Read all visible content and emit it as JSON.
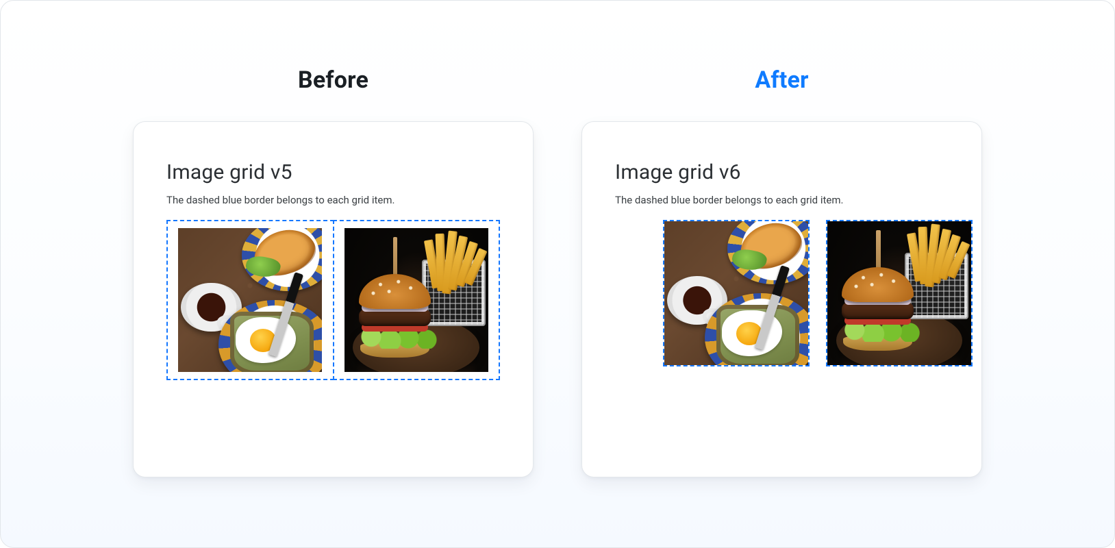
{
  "colors": {
    "accent_blue": "#0f7bff",
    "dashed_border": "#1477ff",
    "text_primary": "#1a1f24",
    "text_body": "#3b4044",
    "card_border": "#e3e7eb"
  },
  "headers": {
    "before": "Before",
    "after": "After"
  },
  "before_card": {
    "title": "Image grid v5",
    "caption": "The dashed blue border belongs to each grid item.",
    "items": [
      {
        "name": "breakfast-photo"
      },
      {
        "name": "burger-photo"
      }
    ]
  },
  "after_card": {
    "title": "Image grid v6",
    "caption": "The dashed blue border belongs to each grid item.",
    "items": [
      {
        "name": "breakfast-photo"
      },
      {
        "name": "burger-photo"
      }
    ]
  }
}
